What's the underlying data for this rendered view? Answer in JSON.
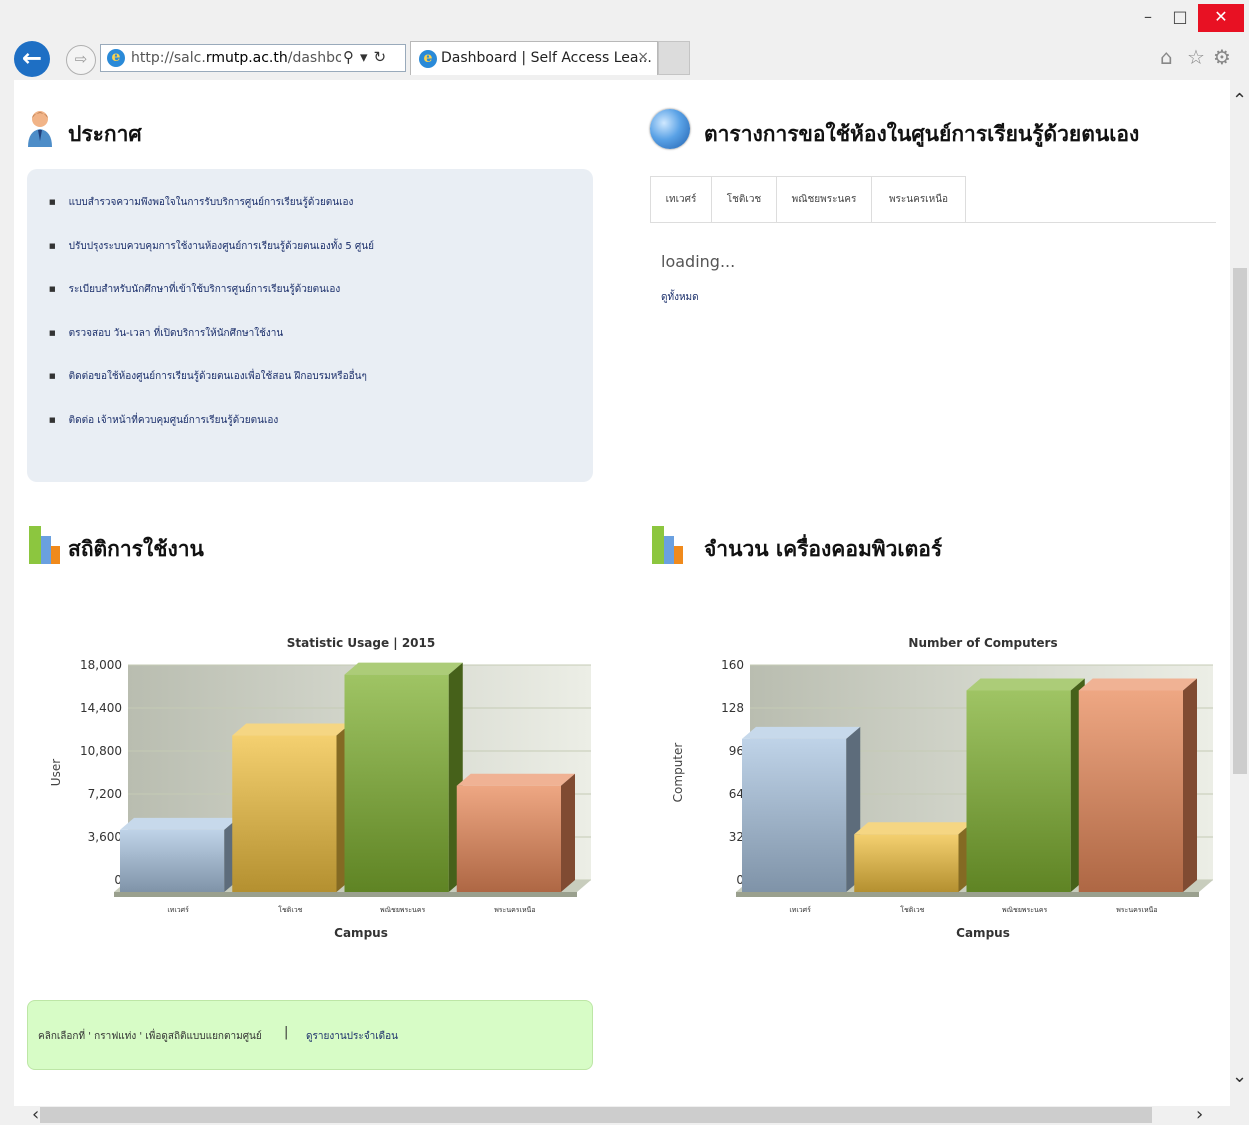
{
  "browser": {
    "window_controls": {
      "minimize": "–",
      "maximize": "□",
      "close": "✕"
    },
    "url_prefix": "http://salc.",
    "url_host": "rmutp.ac.th",
    "url_suffix": "/dashbo:",
    "tab_title": "Dashboard | Self Access Lea...",
    "tab_close": "×",
    "icons": [
      "back-arrow-icon",
      "forward-arrow-icon",
      "ie-logo-icon",
      "search-icon",
      "dropdown-icon",
      "refresh-icon",
      "home-icon",
      "favorites-star-icon",
      "settings-gear-icon"
    ]
  },
  "announcements": {
    "title": "ประกาศ",
    "items": [
      "แบบสำรวจความพึงพอใจในการรับบริการศูนย์การเรียนรู้ด้วยตนเอง",
      "ปรับปรุงระบบควบคุมการใช้งานห้องศูนย์การเรียนรู้ด้วยตนเองทั้ง 5 ศูนย์",
      "ระเบียบสำหรับนักศึกษาที่เข้าใช้บริการศูนย์การเรียนรู้ด้วยตนเอง",
      "ตรวจสอบ วัน-เวลา ที่เปิดบริการให้นักศึกษาใช้งาน",
      "ติดต่อขอใช้ห้องศูนย์การเรียนรู้ด้วยตนเองเพื่อใช้สอน ฝึกอบรมหรืออื่นๆ",
      "ติดต่อ เจ้าหน้าที่ควบคุมศูนย์การเรียนรู้ด้วยตนเอง"
    ]
  },
  "schedule": {
    "title": "ตารางการขอใช้ห้องในศูนย์การเรียนรู้ด้วยตนเอง",
    "tabs": [
      "เทเวศร์",
      "โชติเวช",
      "พณิชยพระนคร",
      "พระนครเหนือ"
    ],
    "loading_text": "loading...",
    "view_all": "ดูทั้งหมด"
  },
  "stats_section": {
    "title": "สถิติการใช้งาน"
  },
  "computers_section": {
    "title": "จำนวน เครื่องคอมพิวเตอร์"
  },
  "chart_data": [
    {
      "type": "bar",
      "title": "Statistic Usage | 2015",
      "xlabel": "Campus",
      "ylabel": "User",
      "categories": [
        "เทเวศร์",
        "โชติเวช",
        "พณิชยพระนคร",
        "พระนครเหนือ"
      ],
      "values": [
        5200,
        13100,
        18200,
        8900
      ],
      "yticks": [
        "0",
        "3,600",
        "7,200",
        "10,800",
        "14,400",
        "18,000"
      ],
      "ylim": [
        0,
        18000
      ],
      "colors": [
        "#a9c4e0",
        "#f0c040",
        "#7fb030",
        "#e8895a"
      ]
    },
    {
      "type": "bar",
      "title": "Number of Computers",
      "xlabel": "Campus",
      "ylabel": "Computer",
      "categories": [
        "เทเวศร์",
        "โชติเวช",
        "พณิชยพระนคร",
        "พระนครเหนือ"
      ],
      "values": [
        114,
        43,
        150,
        150
      ],
      "yticks": [
        "0",
        "32",
        "64",
        "96",
        "128",
        "160"
      ],
      "ylim": [
        0,
        160
      ],
      "colors": [
        "#a9c4e0",
        "#f0c040",
        "#7fb030",
        "#e8895a"
      ]
    }
  ],
  "notice": {
    "text": "คลิกเลือกที่ ' กราฟแท่ง ' เพื่อดูสถิติแบบแยกตามศูนย์",
    "separator": "|",
    "link": "ดูรายงานประจำเดือน"
  }
}
